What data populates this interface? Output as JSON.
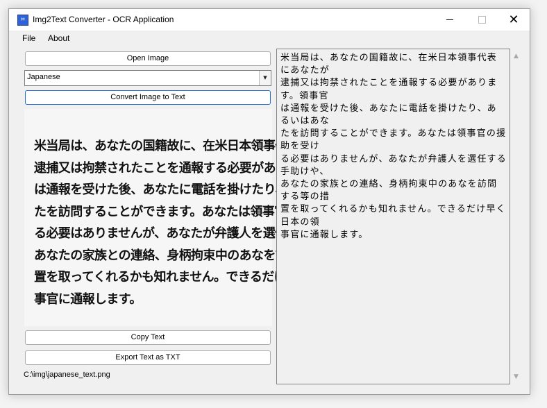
{
  "window": {
    "title": "Img2Text Converter - OCR Application",
    "icon": "app-icon",
    "icon_glyph": "⌗",
    "controls": {
      "minimize": "",
      "maximize": "",
      "close": "✕"
    }
  },
  "menu": {
    "file": "File",
    "about": "About"
  },
  "left": {
    "open_image_label": "Open Image",
    "language_selected": "Japanese",
    "dropdown_arrow": "▼",
    "convert_label": "Convert Image to Text",
    "preview_text": "米当局は、あなたの国籍故に、在米日本領事代表にあなたが\n逮捕又は拘禁されたことを通報する必要があります。領事官\nは通報を受けた後、あなたに電話を掛けたり、あるいはあな\nたを訪問することができます。あなたは領事官の援助を受け\nる必要はありませんが、あなたが弁護人を選任する手助けや、\nあなたの家族との連絡、身柄拘束中のあなを訪問する等の措\n置を取ってくれるかも知れません。できるだけ早く日本の領\n事官に通報します。",
    "copy_label": "Copy Text",
    "export_label": "Export Text as TXT",
    "file_path": "C:\\img\\japanese_text.png"
  },
  "output": {
    "text": "米当局は、あなたの国籍故に、在米日本領事代表にあなたが\n逮捕又は拘禁されたことを通報する必要があります。領事官\nは通報を受けた後、あなたに電話を掛けたり、あるいはあな\nたを訪問することができます。あなたは領事官の援助を受け\nる必要はありませんが、あなたが弁護人を選任する手助けや、\nあなたの家族との連絡、身柄拘束中のあなを訪問する等の措\n置を取ってくれるかも知れません。できるだけ早く日本の領\n事官に通報します。",
    "scroll_up": "▲",
    "scroll_down": "▼"
  },
  "colors": {
    "accent": "#2a6fd6",
    "window_bg": "#f0f0f0",
    "titlebar_bg": "#ffffff"
  }
}
